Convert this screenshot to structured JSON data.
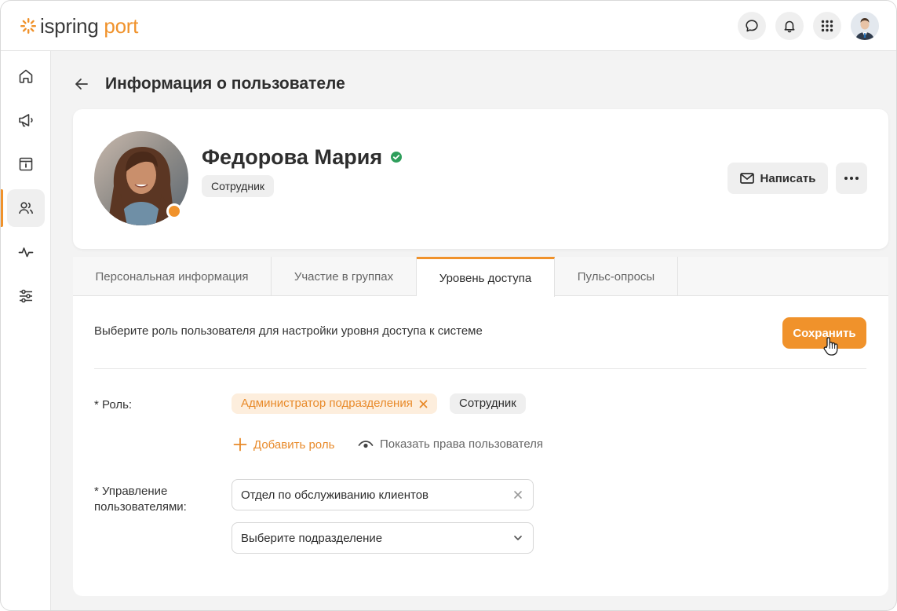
{
  "header": {
    "logo_part1": "ispring",
    "logo_part2": " port",
    "icons": [
      "chat-icon",
      "bell-icon",
      "apps-grid-icon",
      "user-avatar"
    ]
  },
  "sidebar": {
    "items": [
      {
        "name": "home-icon"
      },
      {
        "name": "megaphone-icon"
      },
      {
        "name": "info-box-icon"
      },
      {
        "name": "users-icon",
        "active": true
      },
      {
        "name": "pulse-icon"
      },
      {
        "name": "settings-sliders-icon"
      }
    ]
  },
  "page": {
    "title": "Информация о пользователе"
  },
  "profile": {
    "name": "Федорова Мария",
    "role_chip": "Сотрудник",
    "write_label": "Написать"
  },
  "tabs": [
    {
      "label": "Персональная информация",
      "active": false
    },
    {
      "label": "Участие в группах",
      "active": false
    },
    {
      "label": "Уровень доступа",
      "active": true
    },
    {
      "label": "Пульс-опросы",
      "active": false
    }
  ],
  "access": {
    "hint": "Выберите роль пользователя для настройки уровня доступа к системе",
    "save_label": "Сохранить",
    "role_label": "* Роль:",
    "roles": [
      "Администратор подразделения",
      "Сотрудник"
    ],
    "add_role_label": "Добавить роль",
    "show_rights_label": "Показать права пользователя",
    "manage_label_line1": "* Управление",
    "manage_label_line2": "пользователями:",
    "department_value": "Отдел по обслуживанию клиентов",
    "department_placeholder": "Выберите подразделение"
  },
  "colors": {
    "accent": "#f0922b",
    "accent_soft": "#fdeedd",
    "verified": "#2e9e5b"
  }
}
